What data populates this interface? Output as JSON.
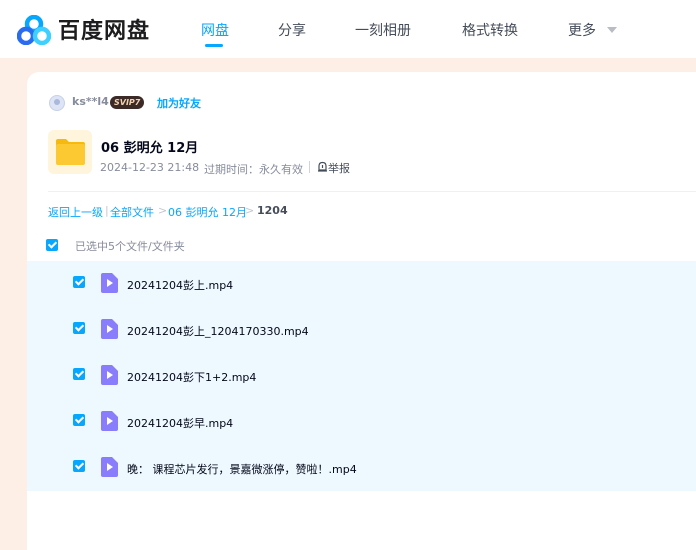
{
  "header": {
    "logo_text": "百度网盘",
    "nav": [
      "网盘",
      "分享",
      "一刻相册",
      "格式转换",
      "更多"
    ]
  },
  "sharer": {
    "username": "ks**l4",
    "badge": "SVIP7",
    "add_friend": "加为好友"
  },
  "folder": {
    "title": "06 彭明允 12月",
    "date": "2024-12-23 21:48",
    "expire": "过期时间：永久有效",
    "report": "举报"
  },
  "breadcrumb": {
    "back": "返回上一级",
    "divider": "|",
    "all_files": "全部文件",
    "arrow": ">",
    "parent": "06 彭明允 12月",
    "current": "1204"
  },
  "selection": {
    "label": "已选中5个文件/文件夹"
  },
  "files": [
    {
      "name": "20241204彭上.mp4"
    },
    {
      "name": "20241204彭上_1204170330.mp4"
    },
    {
      "name": "20241204彭下1+2.mp4"
    },
    {
      "name": "20241204彭早.mp4"
    },
    {
      "name": "晚：  课程芯片发行，景嘉微涨停，赞啦！.mp4"
    }
  ],
  "colors": {
    "accent": "#06a7ff",
    "page_bg": "#fdeee6",
    "selected_row_bg": "#eef8ff",
    "video_icon": "#8a7dfb"
  },
  "icons": [
    "baidu-netdisk-logo-icon",
    "chevron-down-icon",
    "folder-icon",
    "report-icon",
    "checkbox-icon",
    "video-file-icon"
  ]
}
